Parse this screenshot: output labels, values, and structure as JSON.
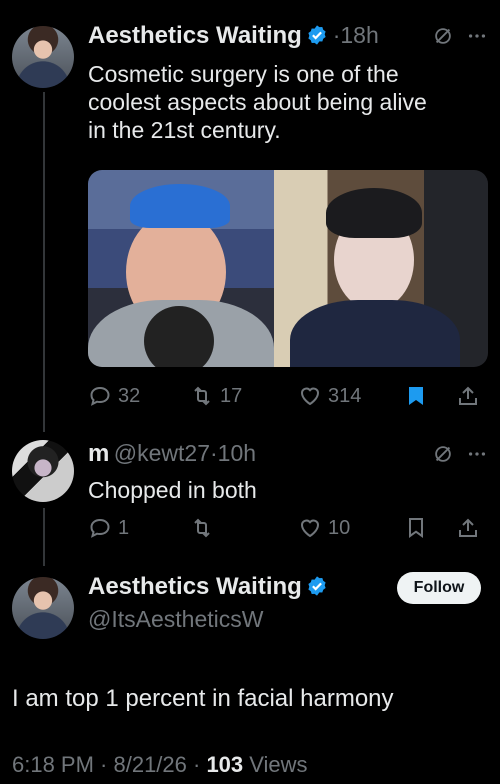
{
  "colors": {
    "accent": "#1d9bf0",
    "muted": "#71767b",
    "text": "#e7e9ea",
    "background": "#000000"
  },
  "tweet1": {
    "author": "Aesthetics Waiting",
    "separator_time": "·18h",
    "text_lines": [
      "Cosmetic surgery is one of the",
      "coolest aspects about being alive",
      "in the 21st century."
    ],
    "replies": "32",
    "reposts": "17",
    "likes": "314"
  },
  "reply": {
    "author": "m",
    "handle_time": "@kewt27·10h",
    "text": "Chopped in both",
    "replies": "1",
    "likes": "10"
  },
  "tweet2": {
    "author": "Aesthetics Waiting",
    "handle": "@ItsAestheticsW",
    "follow_label": "Follow",
    "text": "I am top 1 percent in facial harmony",
    "time_date": "6:18 PM · 8/21/26 · ",
    "views_count": "103",
    "views_label": " Views"
  },
  "icons": [
    "verified-badge-icon",
    "grok-icon",
    "more-icon",
    "reply-icon",
    "repost-icon",
    "like-icon",
    "bookmark-icon",
    "share-icon"
  ]
}
